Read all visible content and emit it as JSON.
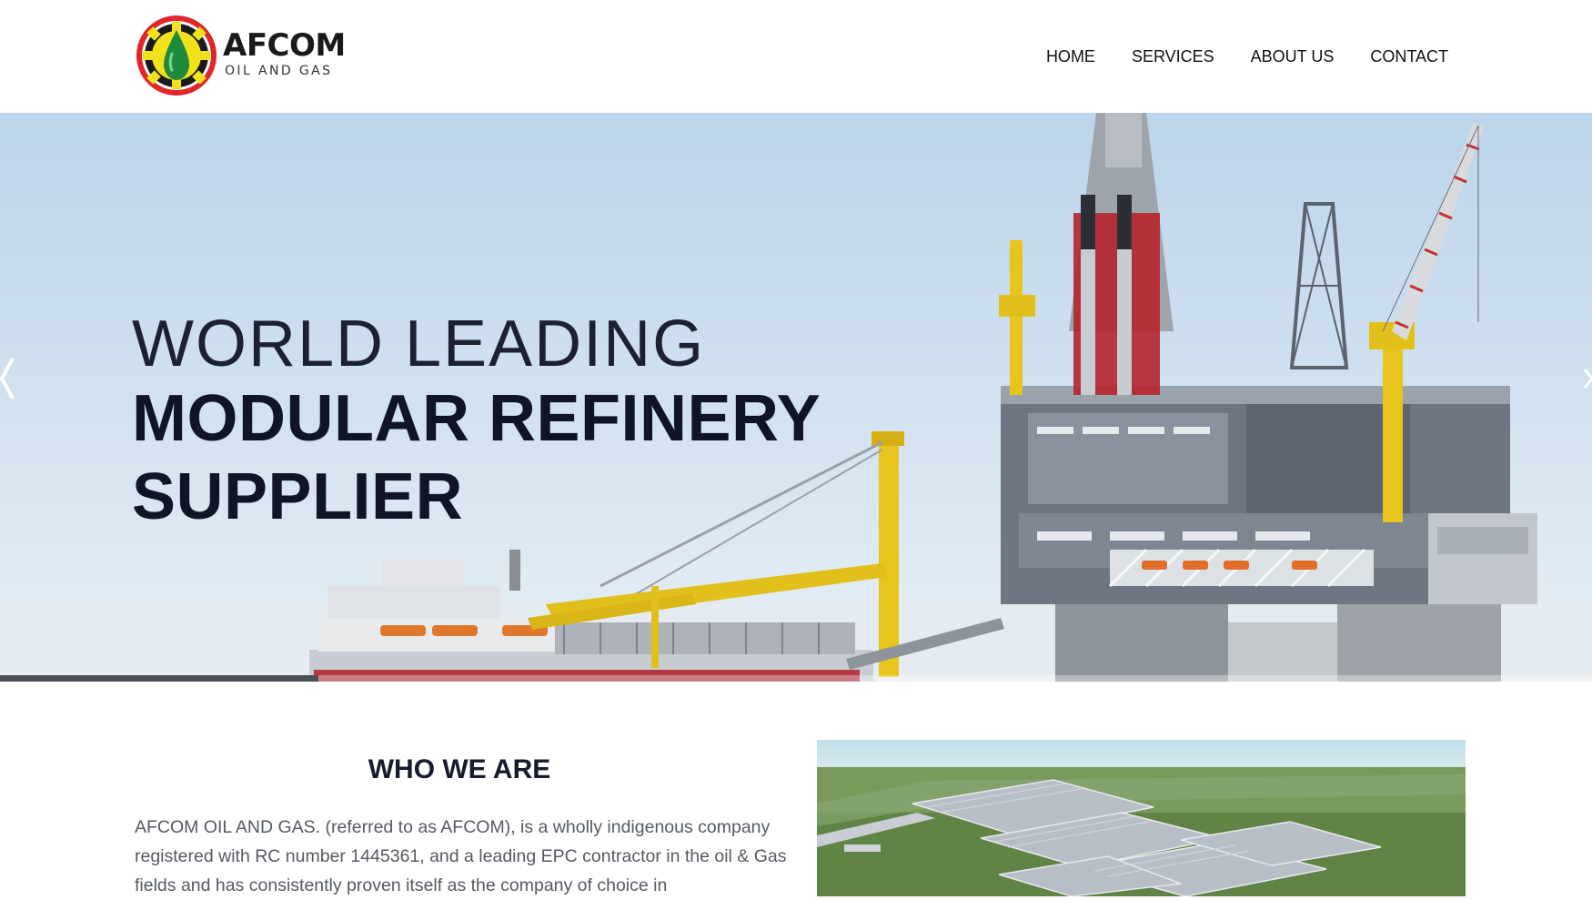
{
  "brand": {
    "name": "AFCOM",
    "tagline": "OIL AND GAS",
    "colors": {
      "ring_red": "#e0262b",
      "gear_yellow": "#f2e21b",
      "drop_green": "#1e8a3c"
    }
  },
  "nav": {
    "items": [
      {
        "label": "HOME"
      },
      {
        "label": "SERVICES"
      },
      {
        "label": "ABOUT US"
      },
      {
        "label": "CONTACT"
      }
    ]
  },
  "hero": {
    "line1": "WORLD LEADING",
    "line2": "MODULAR REFINERY",
    "line3": "SUPPLIER",
    "image": "offshore-oil-platform-photo",
    "prev_icon": "chevron-left-icon",
    "next_icon": "chevron-right-icon",
    "slide_progress_percent": 20
  },
  "about": {
    "title": "WHO WE ARE",
    "body": "AFCOM OIL AND GAS. (referred to as AFCOM), is a wholly indigenous company registered with RC number 1445361, and a leading EPC contractor in the oil & Gas fields and has consistently proven itself as the company of choice in",
    "image": "aerial-refinery-plant-photo"
  }
}
